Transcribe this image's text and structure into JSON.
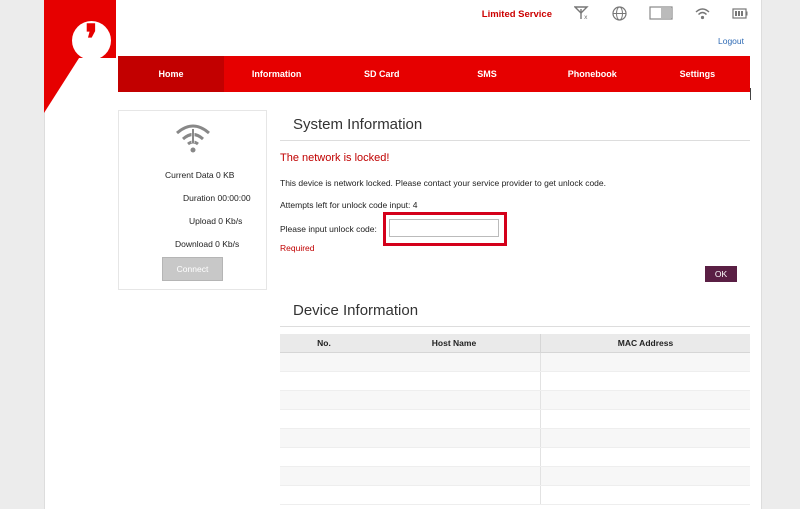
{
  "brand": {
    "logo_name": "vodafone-logo"
  },
  "header": {
    "status_text": "Limited Service",
    "logout_label": "Logout",
    "icons": [
      "no-signal-icon",
      "globe-icon",
      "sim-icon",
      "wifi-icon",
      "battery-icon"
    ]
  },
  "nav": {
    "items": [
      {
        "label": "Home"
      },
      {
        "label": "Information"
      },
      {
        "label": "SD Card"
      },
      {
        "label": "SMS"
      },
      {
        "label": "Phonebook"
      },
      {
        "label": "Settings"
      }
    ]
  },
  "left_panel": {
    "current_data": "Current Data 0 KB",
    "duration": "Duration 00:00:00",
    "upload": "Upload 0 Kb/s",
    "download": "Download 0 Kb/s",
    "connect_label": "Connect"
  },
  "system_info": {
    "title": "System Information",
    "locked_msg": "The network is locked!",
    "description": "This device is network locked. Please contact your service provider to get unlock code.",
    "attempts": "Attempts left for unlock code input: 4",
    "input_label": "Please input unlock code:",
    "input_value": "",
    "required": "Required",
    "ok_label": "OK"
  },
  "device_info": {
    "title": "Device Information",
    "columns": [
      "No.",
      "Host Name",
      "MAC Address"
    ],
    "rows": []
  },
  "colors": {
    "brand_red": "#e60000",
    "active_tab": "#c20000",
    "ok_button": "#5a1f44",
    "status_red": "#cc0000"
  }
}
